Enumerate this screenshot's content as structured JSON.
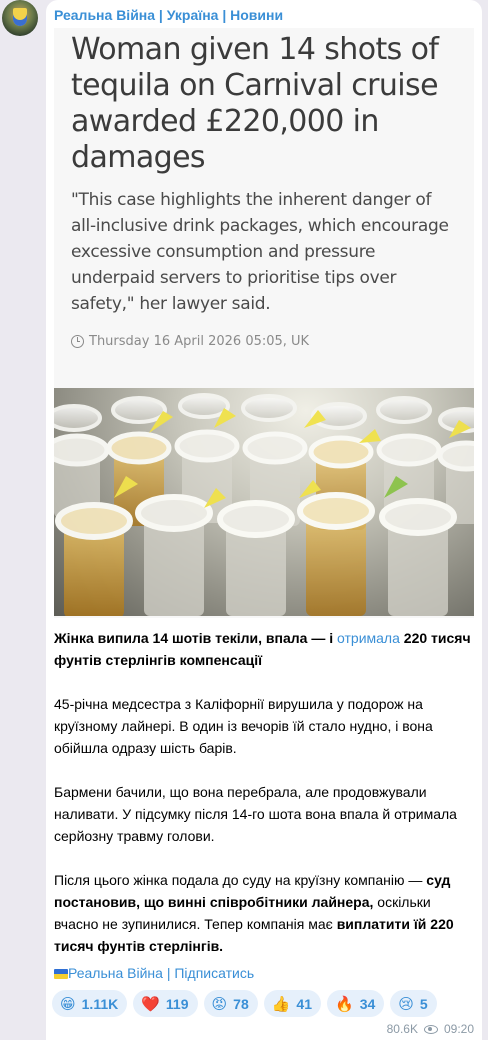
{
  "channel": {
    "name": "Реальна Війна | Україна | Новини"
  },
  "article": {
    "headline": "Woman given 14 shots of tequila on Carnival cruise awarded £220,000 in damages",
    "quote": "\"This case highlights the inherent danger of all-inclusive drink packages, which encourage excessive consumption and pressure underpaid servers to prioritise tips over safety,\" her lawyer said.",
    "dateline": "Thursday 16 April 2026 05:05, UK"
  },
  "message": {
    "lead_part1": "Жінка випила 14 шотів текіли, впала — і ",
    "lead_link": "отримала",
    "lead_part2": " 220 тисяч фунтів стерлінгів компенсації",
    "p2": "45-річна медсестра з Каліфорнії вирушила у подорож на круїзному лайнері. В один із вечорів їй стало нудно, і вона обійшла одразу шість барів.",
    "p3": "Бармени бачили, що вона перебрала, але продовжували наливати. У підсумку після 14-го шота вона впала й отримала серйозну травму голови.",
    "p4_a": "Після цього жінка подала до суду на круїзну компанію — ",
    "p4_b": "суд постановив, що винні співробітники лайнера,",
    "p4_c": " оскільки вчасно не зупинилися. Тепер компанія має ",
    "p4_d": "виплатити їй 220 тисяч фунтів стерлінгів.",
    "signature": "Реальна Війна | Підписатись"
  },
  "reactions": [
    {
      "emoji": "😁",
      "icon": "grin-emoji-icon",
      "count": "1.11K"
    },
    {
      "emoji": "❤️",
      "icon": "heart-emoji-icon",
      "count": "119"
    },
    {
      "emoji": "😡",
      "icon": "angry-emoji-icon",
      "count": "78"
    },
    {
      "emoji": "👍",
      "icon": "thumbs-up-emoji-icon",
      "count": "41"
    },
    {
      "emoji": "🔥",
      "icon": "fire-emoji-icon",
      "count": "34"
    },
    {
      "emoji": "😢",
      "icon": "cry-emoji-icon",
      "count": "5"
    }
  ],
  "meta": {
    "views": "80.6K",
    "time": "09:20"
  },
  "colors": {
    "accent": "#3a8fd6",
    "reaction_bg": "#e6f0fb",
    "background": "#ebe9f0"
  }
}
